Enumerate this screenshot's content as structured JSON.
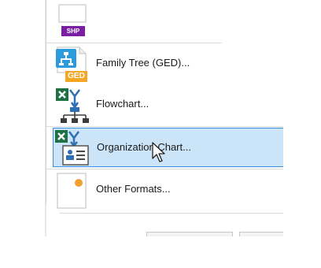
{
  "menu": {
    "items": [
      {
        "label": "",
        "icon": "shp-file-icon",
        "icon_text": "SHP",
        "selected": false
      },
      {
        "label": "Family Tree (GED)...",
        "icon": "family-tree-ged-icon",
        "icon_text": "GED",
        "selected": false
      },
      {
        "label": "Flowchart...",
        "icon": "excel-flowchart-icon",
        "icon_text": "X",
        "selected": false
      },
      {
        "label": "Organization Chart...",
        "icon": "excel-org-chart-icon",
        "icon_text": "X",
        "selected": true
      },
      {
        "label": "Other Formats...",
        "icon": "other-formats-icon",
        "icon_text": "",
        "selected": false
      }
    ]
  },
  "colors": {
    "selection_bg": "#cce4f7",
    "selection_border": "#3a8ee6",
    "excel_green": "#1e7145",
    "shp_purple": "#7a1fa2",
    "ged_orange": "#f5a623",
    "ged_blue": "#2b9be0",
    "flow_blue": "#2f6fb3"
  },
  "cursor": {
    "type": "arrow-pointer",
    "over_item": "Organization Chart..."
  }
}
